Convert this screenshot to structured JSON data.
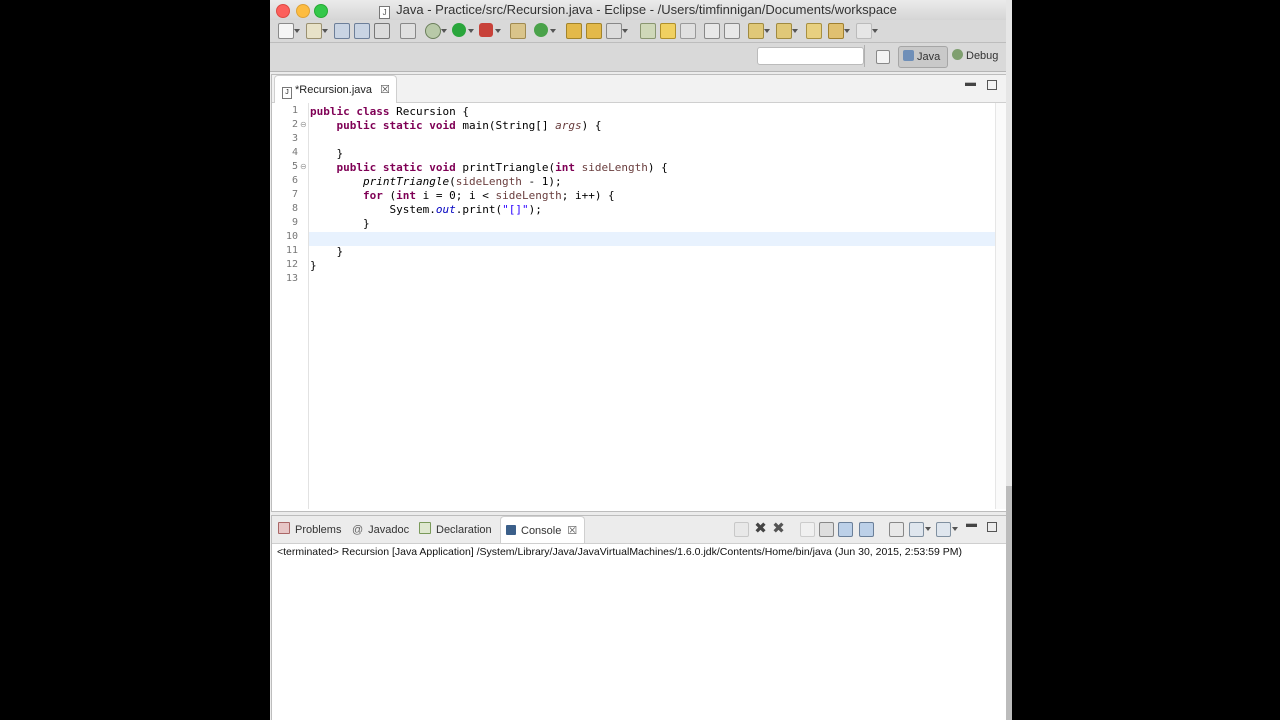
{
  "window": {
    "title": "Java - Practice/src/Recursion.java - Eclipse - /Users/timfinnigan/Documents/workspace",
    "controls": {
      "close_color": "#fc605c",
      "minimize_color": "#fdbc40",
      "zoom_color": "#34c84a"
    }
  },
  "toolbar": {
    "icons": [
      "new-icon",
      "save-icon",
      "save-all-icon",
      "print-icon",
      "skip-breakpoints-icon",
      "debug-icon",
      "run-icon",
      "external-tools-icon",
      "new-java-project-icon",
      "new-package-icon",
      "new-class-icon",
      "open-type-icon",
      "search-icon",
      "mark-occurrences-icon",
      "next-annotation-icon",
      "prev-annotation-icon",
      "back-icon",
      "forward-icon"
    ],
    "search": {
      "value": "",
      "placeholder": ""
    },
    "perspectives": {
      "java_label": "Java",
      "debug_label": "Debug"
    }
  },
  "editor": {
    "tab": {
      "label": "*Recursion.java",
      "close_glyph": "☒"
    },
    "lines": [
      {
        "n": "1"
      },
      {
        "n": "2"
      },
      {
        "n": "3"
      },
      {
        "n": "4"
      },
      {
        "n": "5"
      },
      {
        "n": "6"
      },
      {
        "n": "7"
      },
      {
        "n": "8"
      },
      {
        "n": "9"
      },
      {
        "n": "10"
      },
      {
        "n": "11"
      },
      {
        "n": "12"
      },
      {
        "n": "13"
      }
    ],
    "code": {
      "l1": {
        "kw1": "public",
        "kw2": "class",
        "rest": " Recursion {"
      },
      "l2": {
        "kw1": "public",
        "kw2": "static",
        "kw3": "void",
        "rest1": " main(String[] ",
        "param": "args",
        "rest2": ") {"
      },
      "l4": {
        "rest": "    }"
      },
      "l5": {
        "kw1": "public",
        "kw2": "static",
        "kw3": "void",
        "rest1": " printTriangle(",
        "kw4": "int",
        "param": "sideLength",
        "rest2": ") {"
      },
      "l6": {
        "call": "printTriangle",
        "rest1": "(",
        "param": "sideLength",
        "rest2": " - 1);"
      },
      "l7": {
        "kw1": "for",
        "rest1": " (",
        "kw2": "int",
        "rest2": " i = 0; i < ",
        "param": "sideLength",
        "rest3": "; i++) {"
      },
      "l8": {
        "rest1": "System.",
        "field": "out",
        "rest2": ".print(",
        "str": "\"[]\"",
        "rest3": ");"
      },
      "l9": {
        "rest": "        }"
      },
      "l11": {
        "rest": "    }"
      },
      "l12": {
        "rest": "}"
      }
    }
  },
  "bottom": {
    "tabs": {
      "problems": "Problems",
      "javadoc": "Javadoc",
      "declaration": "Declaration",
      "console": "Console",
      "close_glyph": "☒"
    },
    "console_status": "<terminated> Recursion [Java Application] /System/Library/Java/JavaVirtualMachines/1.6.0.jdk/Contents/Home/bin/java (Jun 30, 2015, 2:53:59 PM)"
  }
}
